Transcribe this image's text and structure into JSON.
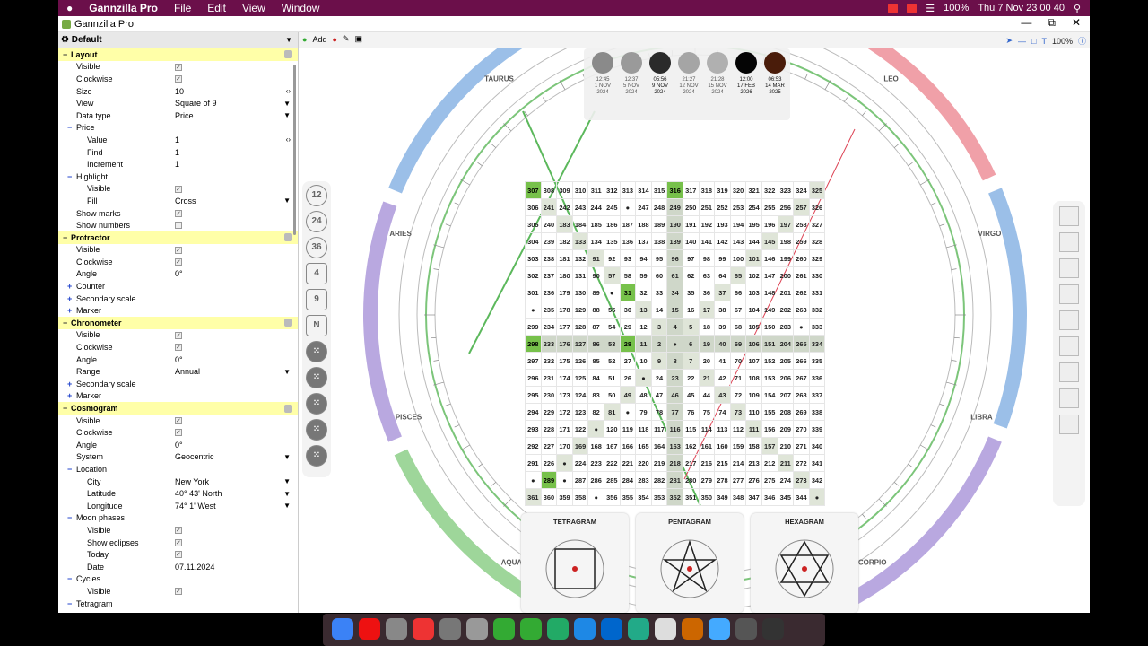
{
  "menubar": {
    "apple": "",
    "app": "Gannzilla Pro",
    "items": [
      "File",
      "Edit",
      "View",
      "Window"
    ],
    "battery": "100%",
    "clock": "Thu 7 Nov  23 00 40"
  },
  "window": {
    "title": "Gannzilla Pro"
  },
  "panel": {
    "profile": "Default",
    "rows": [
      {
        "t": "sec",
        "label": "Layout"
      },
      {
        "label": "Visible",
        "cb": true
      },
      {
        "label": "Clockwise",
        "cb": true
      },
      {
        "label": "Size",
        "value": "10",
        "ctl": "<>"
      },
      {
        "label": "View",
        "value": "Square of 9",
        "ctl": "dd"
      },
      {
        "label": "Data type",
        "value": "Price",
        "ctl": "dd"
      },
      {
        "t": "sub",
        "label": "Price",
        "tg": "-"
      },
      {
        "label": "Value",
        "value": "1",
        "ctl": "<>",
        "ind": 1
      },
      {
        "label": "Find",
        "value": "1",
        "ind": 1
      },
      {
        "label": "Increment",
        "value": "1",
        "ind": 1
      },
      {
        "t": "sub",
        "label": "Highlight",
        "tg": "-"
      },
      {
        "label": "Visible",
        "cb": true,
        "ind": 1
      },
      {
        "label": "Fill",
        "value": "Cross",
        "ctl": "dd",
        "ind": 1
      },
      {
        "label": "Show marks",
        "cb": true
      },
      {
        "label": "Show numbers",
        "cb": false
      },
      {
        "t": "sec",
        "label": "Protractor"
      },
      {
        "label": "Visible",
        "cb": true
      },
      {
        "label": "Clockwise",
        "cb": true
      },
      {
        "label": "Angle",
        "value": "0°"
      },
      {
        "t": "sub",
        "label": "Counter",
        "tg": "+"
      },
      {
        "t": "sub",
        "label": "Secondary scale",
        "tg": "+"
      },
      {
        "t": "sub",
        "label": "Marker",
        "tg": "+"
      },
      {
        "t": "sec",
        "label": "Chronometer"
      },
      {
        "label": "Visible",
        "cb": true
      },
      {
        "label": "Clockwise",
        "cb": true
      },
      {
        "label": "Angle",
        "value": "0°"
      },
      {
        "label": "Range",
        "value": "Annual",
        "ctl": "dd"
      },
      {
        "t": "sub",
        "label": "Secondary scale",
        "tg": "+"
      },
      {
        "t": "sub",
        "label": "Marker",
        "tg": "+"
      },
      {
        "t": "sec",
        "label": "Cosmogram"
      },
      {
        "label": "Visible",
        "cb": true
      },
      {
        "label": "Clockwise",
        "cb": true
      },
      {
        "label": "Angle",
        "value": "0°"
      },
      {
        "label": "System",
        "value": "Geocentric",
        "ctl": "dd"
      },
      {
        "t": "sub",
        "label": "Location",
        "tg": "-"
      },
      {
        "label": "City",
        "value": "New York",
        "ctl": "dd",
        "ind": 1
      },
      {
        "label": "Latitude",
        "value": "40°   43'    North",
        "ctl": "dd",
        "ind": 1
      },
      {
        "label": "Longitude",
        "value": "74°   1'      West",
        "ctl": "dd",
        "ind": 1
      },
      {
        "t": "sub",
        "label": "Moon phases",
        "tg": "-"
      },
      {
        "label": "Visible",
        "cb": true,
        "ind": 1
      },
      {
        "label": "Show eclipses",
        "cb": true,
        "ind": 1
      },
      {
        "label": "Today",
        "cb": true,
        "ind": 1
      },
      {
        "label": "Date",
        "value": "07.11.2024",
        "ind": 1
      },
      {
        "t": "sub",
        "label": "Cycles",
        "tg": "-"
      },
      {
        "label": "Visible",
        "cb": true,
        "ind": 1
      },
      {
        "t": "sub",
        "label": "Tetragram",
        "tg": "-"
      }
    ]
  },
  "toolbar": {
    "add": "Add",
    "zoom": "100%"
  },
  "moon_phases": [
    {
      "time": "12:45",
      "date": "1 NOV",
      "year": "2024"
    },
    {
      "time": "12:37",
      "date": "5 NOV",
      "year": "2024"
    },
    {
      "time": "05:56",
      "date": "9 NOV",
      "year": "2024"
    },
    {
      "time": "21:27",
      "date": "12 NOV",
      "year": "2024"
    },
    {
      "time": "21:28",
      "date": "15 NOV",
      "year": "2024"
    },
    {
      "time": "12:00",
      "date": "17 FEB",
      "year": "2026"
    },
    {
      "time": "06:53",
      "date": "14 MAR",
      "year": "2025"
    }
  ],
  "zodiac": [
    "TAURUS",
    "ARIES",
    "PISCES",
    "AQUARIUS",
    "LEO",
    "VIRGO",
    "LIBRA",
    "SCORPIO"
  ],
  "leftdock": [
    "12",
    "24",
    "36",
    "4",
    "9",
    "N"
  ],
  "grid": [
    [
      307,
      308,
      309,
      310,
      311,
      312,
      313,
      314,
      315,
      316,
      317,
      318,
      319,
      320,
      321,
      322,
      323,
      324,
      325
    ],
    [
      306,
      241,
      242,
      243,
      244,
      245,
      "●",
      247,
      248,
      249,
      250,
      251,
      252,
      253,
      254,
      255,
      256,
      257,
      326
    ],
    [
      305,
      240,
      183,
      184,
      185,
      186,
      187,
      188,
      189,
      190,
      191,
      192,
      193,
      194,
      195,
      196,
      197,
      258,
      327
    ],
    [
      304,
      239,
      182,
      133,
      134,
      135,
      136,
      137,
      138,
      139,
      140,
      141,
      142,
      143,
      144,
      145,
      198,
      259,
      328
    ],
    [
      303,
      238,
      181,
      132,
      91,
      92,
      93,
      94,
      95,
      96,
      97,
      98,
      99,
      100,
      101,
      146,
      199,
      260,
      329
    ],
    [
      302,
      237,
      180,
      131,
      90,
      57,
      58,
      59,
      60,
      61,
      62,
      63,
      64,
      65,
      102,
      147,
      200,
      261,
      330
    ],
    [
      301,
      236,
      179,
      130,
      89,
      "●",
      31,
      32,
      33,
      34,
      35,
      36,
      37,
      66,
      103,
      148,
      201,
      262,
      331
    ],
    [
      "●",
      235,
      178,
      129,
      88,
      55,
      30,
      13,
      14,
      15,
      16,
      17,
      38,
      67,
      104,
      149,
      202,
      263,
      332
    ],
    [
      299,
      234,
      177,
      128,
      87,
      54,
      29,
      12,
      3,
      4,
      5,
      18,
      39,
      68,
      105,
      150,
      203,
      "●",
      333
    ],
    [
      298,
      233,
      176,
      127,
      86,
      53,
      28,
      11,
      2,
      "●",
      6,
      19,
      40,
      69,
      106,
      151,
      204,
      265,
      334
    ],
    [
      297,
      232,
      175,
      126,
      85,
      52,
      27,
      10,
      9,
      8,
      7,
      20,
      41,
      70,
      107,
      152,
      205,
      266,
      335
    ],
    [
      296,
      231,
      174,
      125,
      84,
      51,
      26,
      "●",
      24,
      23,
      22,
      21,
      42,
      71,
      108,
      153,
      206,
      267,
      336
    ],
    [
      295,
      230,
      173,
      124,
      83,
      50,
      49,
      48,
      47,
      46,
      45,
      44,
      43,
      72,
      109,
      154,
      207,
      268,
      337
    ],
    [
      294,
      229,
      172,
      123,
      82,
      81,
      "●",
      79,
      78,
      77,
      76,
      75,
      74,
      73,
      110,
      155,
      208,
      269,
      338
    ],
    [
      293,
      228,
      171,
      122,
      "●",
      120,
      119,
      118,
      117,
      116,
      115,
      114,
      113,
      112,
      111,
      156,
      209,
      270,
      339
    ],
    [
      292,
      227,
      170,
      169,
      168,
      167,
      166,
      165,
      164,
      163,
      162,
      161,
      160,
      159,
      158,
      157,
      210,
      271,
      340
    ],
    [
      291,
      226,
      "●",
      224,
      223,
      222,
      221,
      220,
      219,
      218,
      217,
      216,
      215,
      214,
      213,
      212,
      211,
      272,
      341
    ],
    [
      "●",
      289,
      "●",
      287,
      286,
      285,
      284,
      283,
      282,
      281,
      280,
      279,
      278,
      277,
      276,
      275,
      274,
      273,
      342
    ],
    [
      361,
      360,
      359,
      358,
      "●",
      356,
      355,
      354,
      353,
      352,
      351,
      350,
      349,
      348,
      347,
      346,
      345,
      344,
      "●"
    ]
  ],
  "cards": [
    {
      "title": "TETRAGRAM"
    },
    {
      "title": "PENTAGRAM"
    },
    {
      "title": "HEXAGRAM"
    }
  ],
  "colors": {
    "menubar": "#6b0f4a",
    "highlight": "#77c14b",
    "section": "#ffffa8"
  }
}
